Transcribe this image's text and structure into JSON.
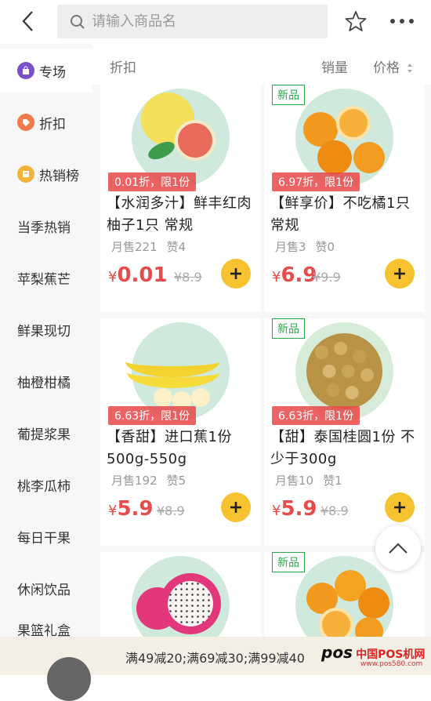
{
  "header": {
    "search_placeholder": "请输入商品名"
  },
  "sidebar": {
    "items": [
      {
        "label": "专场"
      },
      {
        "label": "折扣"
      },
      {
        "label": "热销榜"
      },
      {
        "label": "当季热销"
      },
      {
        "label": "苹梨蕉芒"
      },
      {
        "label": "鲜果现切"
      },
      {
        "label": "柚橙柑橘"
      },
      {
        "label": "葡提浆果"
      },
      {
        "label": "桃李瓜柿"
      },
      {
        "label": "每日干果"
      },
      {
        "label": "休闲饮品"
      },
      {
        "label": "果篮礼盒"
      }
    ]
  },
  "filter": {
    "title": "折扣",
    "sales": "销量",
    "price": "价格"
  },
  "products": [
    {
      "name": "【水润多汁】鲜丰红肉柚子1只 常规",
      "promo": "0.01折，限1份",
      "sales": "月售221",
      "likes": "赞4",
      "currency": "¥",
      "price": "0.01",
      "old_price": "¥8.9",
      "new_tag": ""
    },
    {
      "name": "【鲜享价】不吃橘1只 常规",
      "promo": "6.97折，限1份",
      "sales": "月售3",
      "likes": "赞0",
      "currency": "¥",
      "price": "6.9",
      "old_price": "¥9.9",
      "new_tag": "新品"
    },
    {
      "name": "【香甜】进口蕉1份 500g-550g",
      "promo": "6.63折，限1份",
      "sales": "月售192",
      "likes": "赞5",
      "currency": "¥",
      "price": "5.9",
      "old_price": "¥8.9",
      "new_tag": ""
    },
    {
      "name": "【甜】泰国桂圆1份 不少于300g",
      "promo": "6.63折，限1份",
      "sales": "月售10",
      "likes": "赞1",
      "currency": "¥",
      "price": "5.9",
      "old_price": "¥8.9",
      "new_tag": "新品"
    },
    {
      "name": "",
      "promo": "",
      "sales": "",
      "likes": "",
      "currency": "",
      "price": "",
      "old_price": "",
      "new_tag": ""
    },
    {
      "name": "",
      "promo": "",
      "sales": "",
      "likes": "",
      "currency": "",
      "price": "",
      "old_price": "",
      "new_tag": "新品"
    }
  ],
  "bottom": {
    "promo_text": "满49减20;满69减30;满99减40"
  },
  "watermark": {
    "brand": "pos",
    "site": "中国POS机网",
    "url": "www.pos580.com"
  },
  "colors": {
    "accent": "#f6c230",
    "price": "#e94a4a",
    "new_tag": "#2aa84a",
    "sidebar_bg": "#f7f7f7"
  },
  "icons": {
    "back": "chevron-left-icon",
    "search": "search-icon",
    "star": "star-icon",
    "more": "more-dots-icon",
    "add": "plus-icon",
    "to_top": "chevron-up-icon"
  }
}
